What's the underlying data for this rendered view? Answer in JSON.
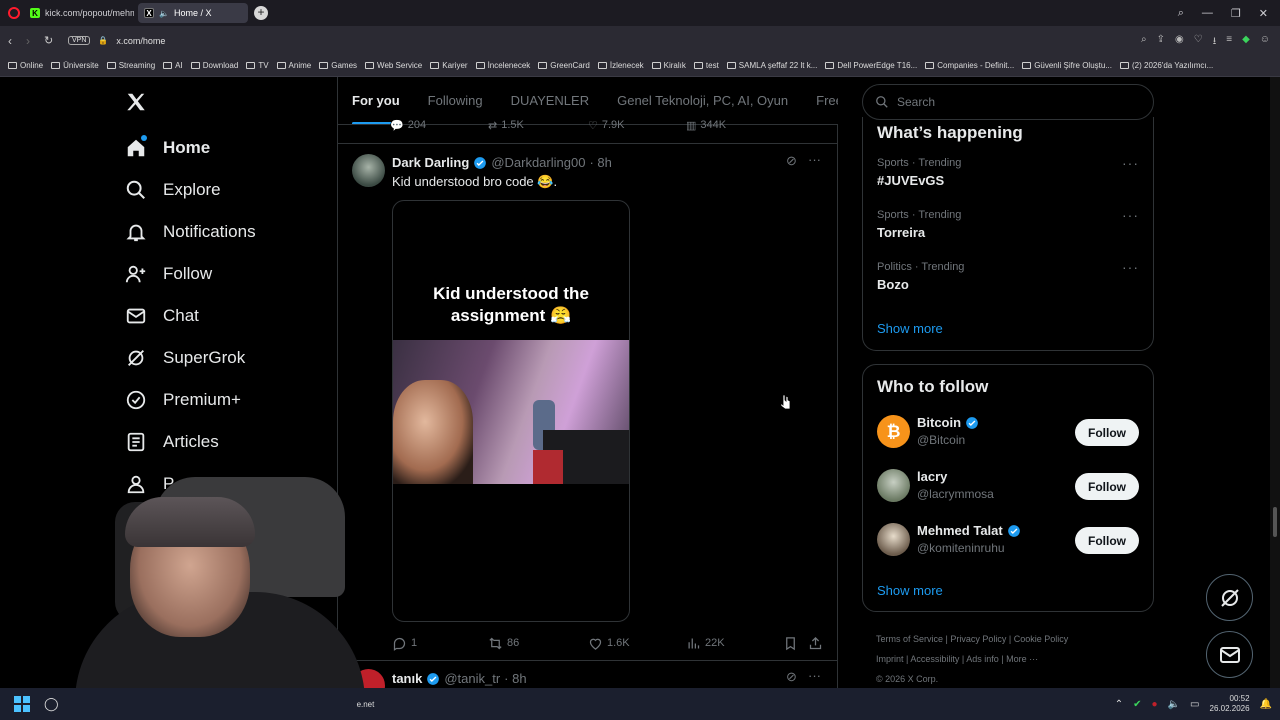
{
  "browser": {
    "tabs": [
      {
        "title": "kick.com/popout/mehmet",
        "favicon": "K",
        "color": "#53fc18"
      },
      {
        "title": "Home / X",
        "favicon": "X",
        "color": "#ffffff"
      }
    ],
    "url": "x.com/home",
    "vpn_label": "VPN",
    "bookmarks": [
      "Online",
      "Üniversite",
      "Streaming",
      "AI",
      "Download",
      "TV",
      "Anime",
      "Games",
      "Web Service",
      "Kariyer",
      "İncelenecek",
      "GreenCard",
      "İzlenecek",
      "Kiralık",
      "test",
      "SAMLA şeffaf 22 lt k...",
      "Dell PowerEdge T16...",
      "Companies - Definit...",
      "Güvenli Şifre Oluştu...",
      "(2) 2026'da Yazılımcı..."
    ]
  },
  "nav": {
    "logo": "X",
    "items": [
      {
        "label": "Home",
        "icon": "home-icon"
      },
      {
        "label": "Explore",
        "icon": "search-icon"
      },
      {
        "label": "Notifications",
        "icon": "bell-icon"
      },
      {
        "label": "Follow",
        "icon": "follow-icon"
      },
      {
        "label": "Chat",
        "icon": "mail-icon"
      },
      {
        "label": "SuperGrok",
        "icon": "grok-icon"
      },
      {
        "label": "Premium+",
        "icon": "verified-icon"
      },
      {
        "label": "Articles",
        "icon": "articles-icon"
      },
      {
        "label": "P",
        "icon": "profile-icon"
      }
    ]
  },
  "timeline": {
    "tabs": [
      "For you",
      "Following",
      "DUAYENLER",
      "Genel Teknoloji, PC, AI, Oyun",
      "Free G"
    ],
    "prev_actions": {
      "replies": "204",
      "reposts": "1.5K",
      "likes": "7.9K",
      "views": "344K"
    },
    "post": {
      "name": "Dark Darling",
      "handle": "@Darkdarling00",
      "time": "· 8h",
      "text": "Kid understood bro code 😂.",
      "media_caption": "Kid understood the assignment 😤",
      "replies": "1",
      "reposts": "86",
      "likes": "1.6K",
      "views": "22K"
    },
    "next_post": {
      "name": "tanık",
      "handle": "@tanik_tr",
      "time": "· 8h"
    }
  },
  "search": {
    "placeholder": "Search"
  },
  "trends": {
    "title": "What’s happening",
    "items": [
      {
        "meta": "Sports · Trending",
        "name": "#JUVEvGS"
      },
      {
        "meta": "Sports · Trending",
        "name": "Torreira"
      },
      {
        "meta": "Politics · Trending",
        "name": "Bozo"
      }
    ],
    "show_more": "Show more"
  },
  "who_to_follow": {
    "title": "Who to follow",
    "users": [
      {
        "name": "Bitcoin",
        "handle": "@Bitcoin",
        "verified": true,
        "button": "Follow"
      },
      {
        "name": "lacry",
        "handle": "@lacrymmosa",
        "verified": false,
        "button": "Follow"
      },
      {
        "name": "Mehmed Talat",
        "handle": "@komiteninruhu",
        "verified": true,
        "button": "Follow"
      }
    ],
    "show_more": "Show more"
  },
  "footer": {
    "links": [
      "Terms of Service",
      "Privacy Policy",
      "Cookie Policy",
      "Imprint",
      "Accessibility",
      "Ads info",
      "More ···"
    ],
    "copyright": "© 2026 X Corp."
  },
  "taskbar": {
    "time": "00:52",
    "date": "26.02.2026",
    "partial_text": "e.net"
  },
  "colors": {
    "accent": "#1d9bf0",
    "background": "#000000",
    "border": "#2f3336"
  }
}
